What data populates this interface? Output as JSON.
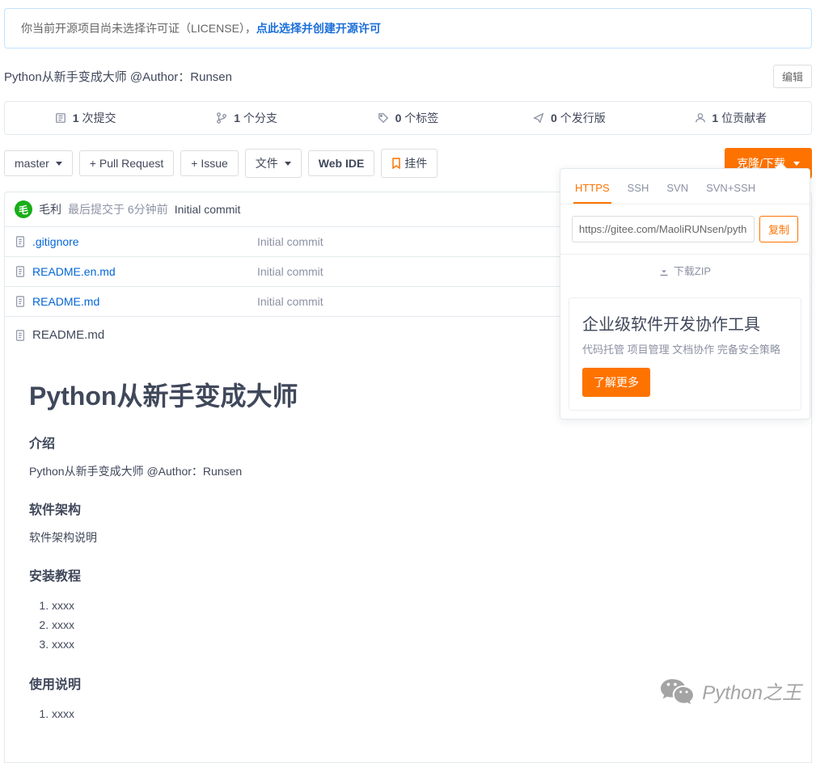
{
  "license_banner": {
    "prefix": "你当前开源项目尚未选择许可证（LICENSE），",
    "action": "点此选择并创建开源许可"
  },
  "repo": {
    "description": "Python从新手变成大师 @Author：Runsen",
    "edit": "编辑"
  },
  "stats": {
    "commits": {
      "num": "1",
      "label": " 次提交"
    },
    "branches": {
      "num": "1",
      "label": " 个分支"
    },
    "tags": {
      "num": "0",
      "label": " 个标签"
    },
    "releases": {
      "num": "0",
      "label": " 个发行版"
    },
    "contributors": {
      "num": "1",
      "label": " 位贡献者"
    }
  },
  "toolbar": {
    "branch": "master",
    "pull_request": "+ Pull Request",
    "issue": "+ Issue",
    "files": "文件",
    "web_ide": "Web IDE",
    "pendant": "挂件",
    "clone": "克隆/下载"
  },
  "commit": {
    "avatar_initial": "毛",
    "author": "毛利",
    "meta": "最后提交于 6分钟前",
    "msg": "Initial commit"
  },
  "files": [
    {
      "name": ".gitignore",
      "msg": "Initial commit"
    },
    {
      "name": "README.en.md",
      "msg": "Initial commit"
    },
    {
      "name": "README.md",
      "msg": "Initial commit"
    }
  ],
  "readme": {
    "filename": "README.md",
    "h1": "Python从新手变成大师",
    "s1": {
      "title": "介绍",
      "body": "Python从新手变成大师 @Author：Runsen"
    },
    "s2": {
      "title": "软件架构",
      "body": "软件架构说明"
    },
    "s3": {
      "title": "安装教程",
      "items": [
        "xxxx",
        "xxxx",
        "xxxx"
      ]
    },
    "s4": {
      "title": "使用说明",
      "items": [
        "xxxx"
      ]
    }
  },
  "clone_popup": {
    "tabs": [
      "HTTPS",
      "SSH",
      "SVN",
      "SVN+SSH"
    ],
    "url": "https://gitee.com/MaoliRUNsen/pytho",
    "copy": "复制",
    "download_zip": "下载ZIP",
    "promo_title": "企业级软件开发协作工具",
    "promo_sub": "代码托管 项目管理 文档协作 完备安全策略",
    "promo_btn": "了解更多"
  },
  "watermark": "Python之王"
}
